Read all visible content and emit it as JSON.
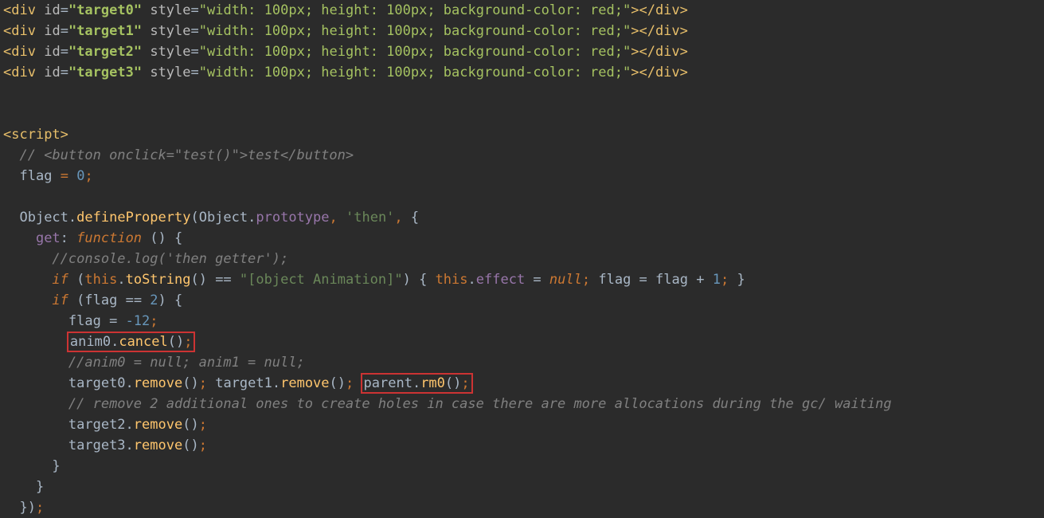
{
  "divs": [
    {
      "id": "target0",
      "style": "width: 100px; height: 100px; background-color: red;"
    },
    {
      "id": "target1",
      "style": "width: 100px; height: 100px; background-color: red;"
    },
    {
      "id": "target2",
      "style": "width: 100px; height: 100px; background-color: red;"
    },
    {
      "id": "target3",
      "style": "width: 100px; height: 100px; background-color: red;"
    }
  ],
  "script_open": "script",
  "script_close": "script",
  "comment_button": "// <button onclick=\"test()\">test</button>",
  "flag_init_name": "flag",
  "flag_init_val": "0",
  "defprop": {
    "obj": "Object",
    "method": "defineProperty",
    "proto_obj": "Object",
    "proto_prop": "prototype",
    "then_str": "'then'",
    "get_key": "get",
    "function_kw": "function"
  },
  "getter": {
    "comment_log": "//console.log('then getter');",
    "if_kw": "if",
    "this_kw": "this",
    "toString": "toString",
    "cmp_str": "\"[object Animation]\"",
    "effect": "effect",
    "null_kw": "null",
    "flag_name": "flag",
    "plus_one": "1",
    "flag_eq2": "2",
    "flag_neg12": "-12",
    "anim0_cancel": "anim0.cancel();",
    "comment_anim_null": "//anim0 = null; anim1 = null;",
    "t0_remove": "target0.remove();",
    "t1_remove": "target1.remove();",
    "parent_rm0": "parent.rm0();",
    "comment_holes": "// remove 2 additional ones to create holes in case there are more allocations during the gc/ waiting",
    "t2_remove": "target2.remove();",
    "t3_remove": "target3.remove();"
  }
}
